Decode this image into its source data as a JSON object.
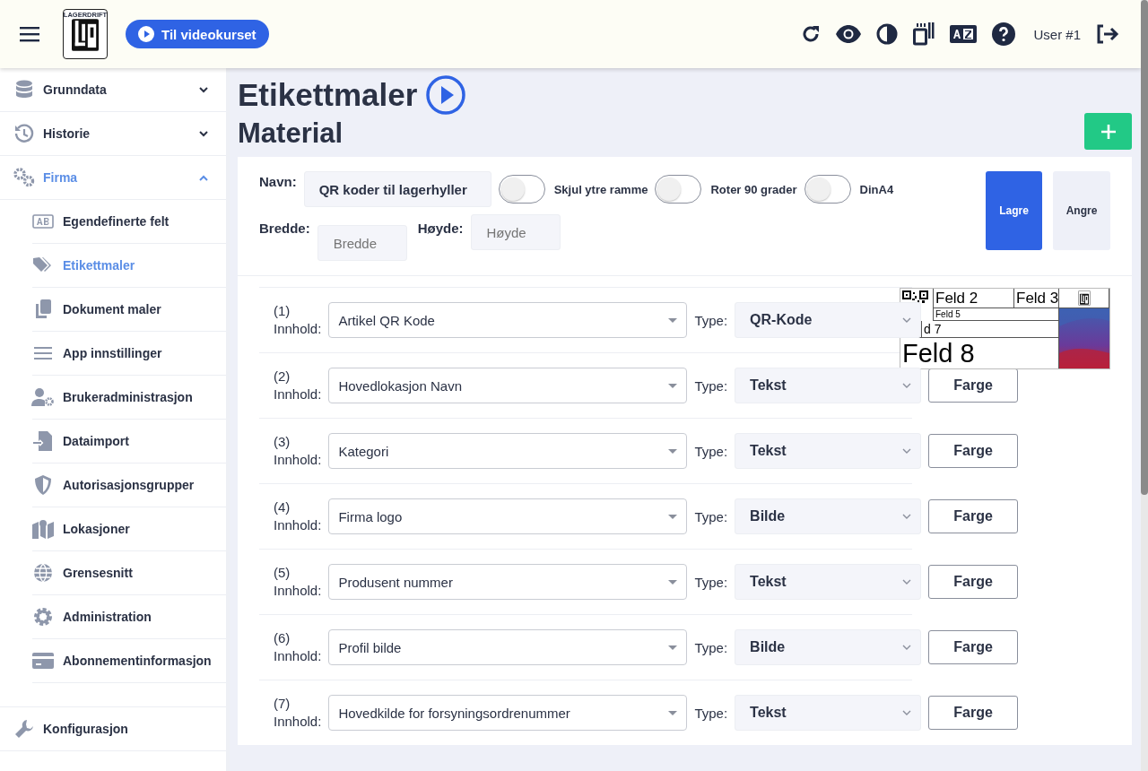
{
  "header": {
    "video_button": "Til videokurset",
    "logo_text": "LAGERDRIFT",
    "user": "User #1"
  },
  "sidebar": {
    "items": [
      {
        "label": "Grunndata",
        "expanded": false
      },
      {
        "label": "Historie",
        "expanded": false
      },
      {
        "label": "Firma",
        "expanded": true,
        "children": [
          {
            "label": "Egendefinerte felt",
            "selected": false
          },
          {
            "label": "Etikettmaler",
            "selected": true
          },
          {
            "label": "Dokument maler",
            "selected": false
          },
          {
            "label": "App innstillinger",
            "selected": false
          },
          {
            "label": "Brukeradministrasjon",
            "selected": false
          },
          {
            "label": "Dataimport",
            "selected": false
          },
          {
            "label": "Autorisasjonsgrupper",
            "selected": false
          },
          {
            "label": "Lokasjoner",
            "selected": false
          },
          {
            "label": "Grensesnitt",
            "selected": false
          },
          {
            "label": "Administration",
            "selected": false
          },
          {
            "label": "Abonnementinformasjon",
            "selected": false
          }
        ]
      },
      {
        "label": "Konfigurasjon"
      }
    ]
  },
  "page": {
    "title": "Etikettmaler",
    "subtitle": "Material"
  },
  "form": {
    "name_label": "Navn:",
    "name_value": "QR koder til lagerhyller",
    "toggles": [
      {
        "label": "Skjul ytre ramme",
        "on": false
      },
      {
        "label": "Roter 90 grader",
        "on": false
      },
      {
        "label": "DinA4",
        "on": false
      }
    ],
    "width": {
      "label": "Bredde:",
      "placeholder": "Bredde"
    },
    "height": {
      "label": "Høyde:",
      "placeholder": "Høyde"
    },
    "save_button": "Lagre",
    "cancel_button": "Angre"
  },
  "rows": [
    {
      "number": "(1)",
      "label": "Innhold:",
      "content": "Artikel QR Kode",
      "type_label": "Type:",
      "type": "QR-Kode"
    },
    {
      "number": "(2)",
      "label": "Innhold:",
      "content": "Hovedlokasjon Navn",
      "type_label": "Type:",
      "type": "Tekst",
      "color_button": "Farge"
    },
    {
      "number": "(3)",
      "label": "Innhold:",
      "content": "Kategori",
      "type_label": "Type:",
      "type": "Tekst",
      "color_button": "Farge"
    },
    {
      "number": "(4)",
      "label": "Innhold:",
      "content": "Firma logo",
      "type_label": "Type:",
      "type": "Bilde",
      "color_button": "Farge"
    },
    {
      "number": "(5)",
      "label": "Innhold:",
      "content": "Produsent nummer",
      "type_label": "Type:",
      "type": "Tekst",
      "color_button": "Farge"
    },
    {
      "number": "(6)",
      "label": "Innhold:",
      "content": "Profil bilde",
      "type_label": "Type:",
      "type": "Bilde",
      "color_button": "Farge"
    },
    {
      "number": "(7)",
      "label": "Innhold:",
      "content": "Hovedkilde for forsyningsordrenummer",
      "type_label": "Type:",
      "type": "Tekst",
      "color_button": "Farge"
    }
  ],
  "preview": {
    "field_2": "Feld 2",
    "field_3": "Feld 3",
    "field_5": "Feld 5",
    "field_7": "d 7",
    "field_8": "Feld 8"
  }
}
